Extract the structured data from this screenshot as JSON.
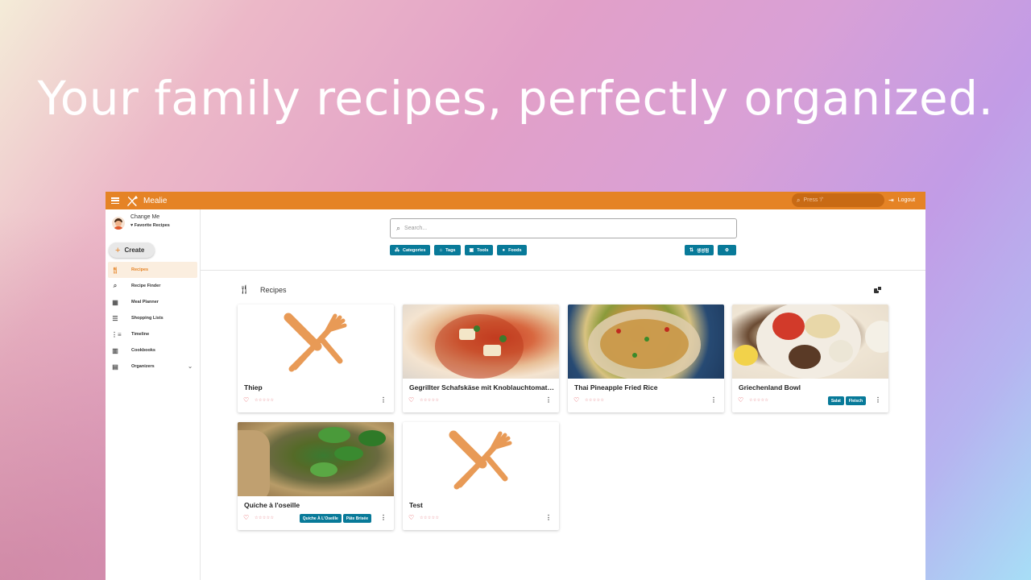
{
  "headline": "Your family recipes, perfectly organized.",
  "appbar": {
    "title": "Mealie",
    "search_placeholder": "Press '/'",
    "logout_label": "Logout"
  },
  "sidebar": {
    "user_name": "Change Me",
    "favorites_label": "Favorite Recipes",
    "create_label": "Create",
    "items": [
      {
        "label": "Recipes",
        "icon": "fork-knife-icon",
        "active": true
      },
      {
        "label": "Recipe Finder",
        "icon": "search-icon"
      },
      {
        "label": "Meal Planner",
        "icon": "calendar-icon"
      },
      {
        "label": "Shopping Lists",
        "icon": "checklist-icon"
      },
      {
        "label": "Timeline",
        "icon": "timeline-icon"
      },
      {
        "label": "Cookbooks",
        "icon": "book-icon"
      },
      {
        "label": "Organizers",
        "icon": "organizer-icon"
      }
    ]
  },
  "search": {
    "placeholder": "Search...",
    "filters": [
      "Categories",
      "Tags",
      "Tools",
      "Foods"
    ],
    "sort_label": "생성됨"
  },
  "section": {
    "title": "Recipes"
  },
  "recipes": [
    {
      "name": "Thiep",
      "image": "placeholder",
      "tags": []
    },
    {
      "name": "Gegrillter Schafskäse mit Knoblauchtomaten",
      "image": "photo",
      "tags": []
    },
    {
      "name": "Thai Pineapple Fried Rice",
      "image": "photo",
      "tags": []
    },
    {
      "name": "Griechenland Bowl",
      "image": "photo",
      "tags": [
        "Salat",
        "Fleisch"
      ]
    },
    {
      "name": "Quiche à l'oseille",
      "image": "photo",
      "tags": [
        "Quiche À L'Oseille",
        "Pâte Brisée"
      ]
    },
    {
      "name": "Test",
      "image": "placeholder",
      "tags": []
    }
  ],
  "colors": {
    "accent": "#e58325",
    "chip": "#087a99",
    "heart": "#e0353b"
  }
}
